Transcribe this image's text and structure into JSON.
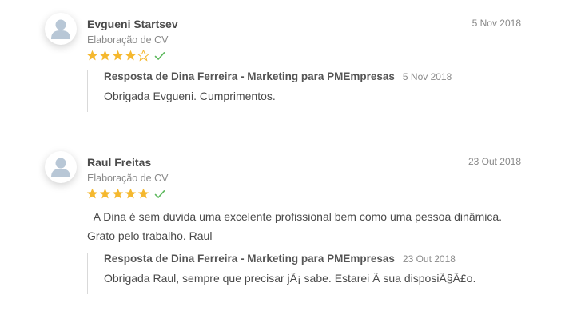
{
  "reviews": [
    {
      "author": "Evgueni Startsev",
      "service": "Elaboração de CV",
      "date": "5 Nov 2018",
      "rating": 4,
      "max_rating": 5,
      "verified_icon": "check-icon",
      "text": "",
      "reply": {
        "author": "Resposta de Dina Ferreira - Marketing para PMEmpresas",
        "date": "5 Nov 2018",
        "text": "Obrigada Evgueni. Cumprimentos."
      }
    },
    {
      "author": "Raul Freitas",
      "service": "Elaboração de CV",
      "date": "23 Out 2018",
      "rating": 5,
      "max_rating": 5,
      "verified_icon": "check-icon",
      "text": "  A Dina é sem duvida uma excelente profissional bem como uma pessoa dinâmica. Grato pelo trabalho. Raul",
      "reply": {
        "author": "Resposta de Dina Ferreira - Marketing para PMEmpresas",
        "date": "23 Out 2018",
        "text": "Obrigada Raul, sempre que precisar jÃ¡ sabe. Estarei Ã  sua disposiÃ§Ã£o."
      }
    }
  ],
  "colors": {
    "star_filled": "#f5b82e",
    "star_empty": "#f5b82e",
    "check": "#5cb85c",
    "avatar_fg": "#b8c7d6"
  }
}
